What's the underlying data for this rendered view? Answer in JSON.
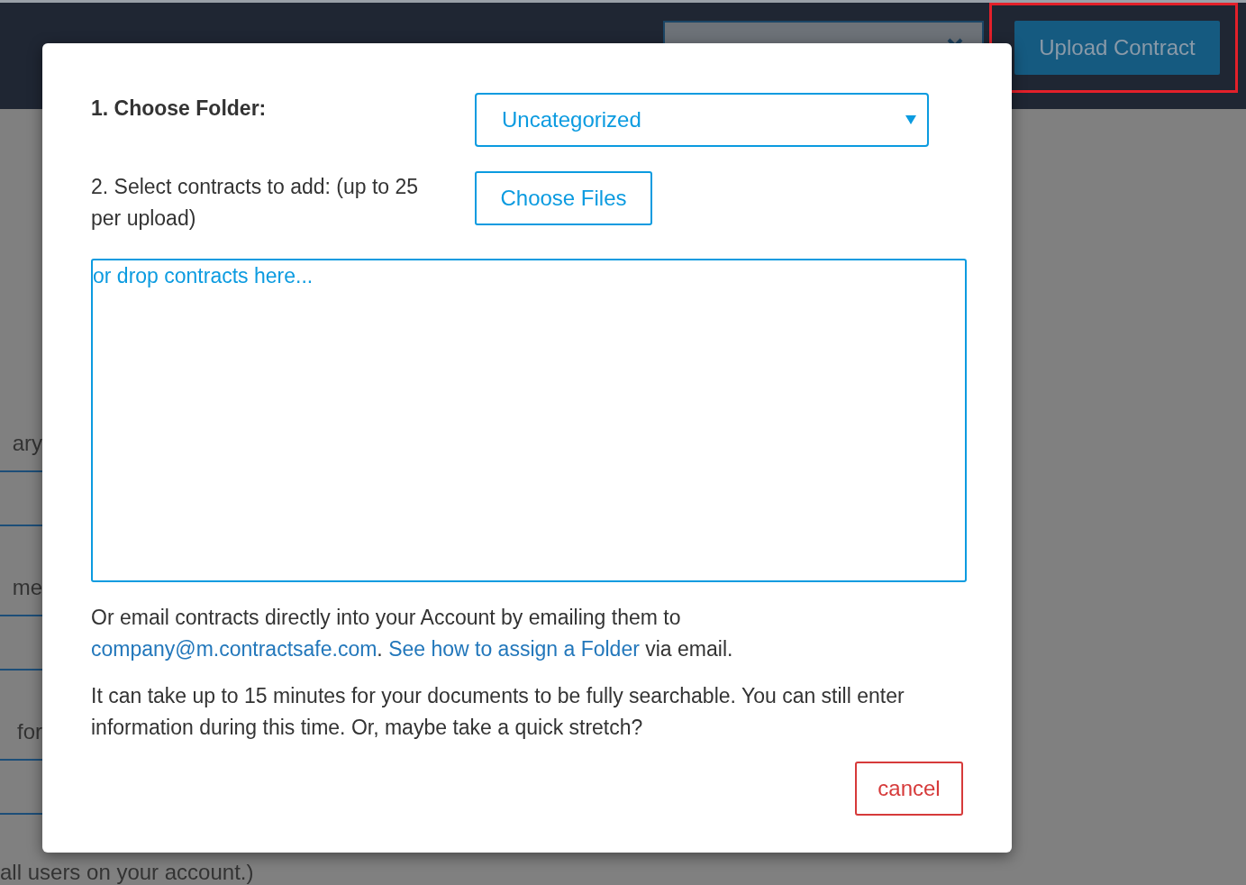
{
  "header": {
    "upload_button": "Upload Contract"
  },
  "background_rows": [
    {
      "text": "ary",
      "kind": "text"
    },
    {
      "kind": "blank"
    },
    {
      "text": "me",
      "kind": "text"
    },
    {
      "kind": "blank"
    },
    {
      "text": "for",
      "kind": "text"
    },
    {
      "kind": "blank"
    }
  ],
  "background_footer": "all users on your account.)",
  "modal": {
    "folder_label": "1. Choose Folder:",
    "folder_select": "Uncategorized",
    "files_label": "2. Select contracts to add: (up to 25 per upload)",
    "files_button": "Choose Files",
    "drop_zone": "or drop contracts here...",
    "email_note": [
      {
        "kind": "text",
        "text": "Or email contracts directly into your Account by emailing them to "
      },
      {
        "kind": "link",
        "text": "company@m.contractsafe.com"
      },
      {
        "kind": "text",
        "text": ". "
      },
      {
        "kind": "link",
        "text": "See how to assign a Folder"
      },
      {
        "kind": "text",
        "text": " via email."
      }
    ],
    "info_note": "It can take up to 15 minutes for your documents to be fully searchable. You can still enter information during this time. Or, maybe take a quick stretch?",
    "cancel_button": "cancel"
  }
}
